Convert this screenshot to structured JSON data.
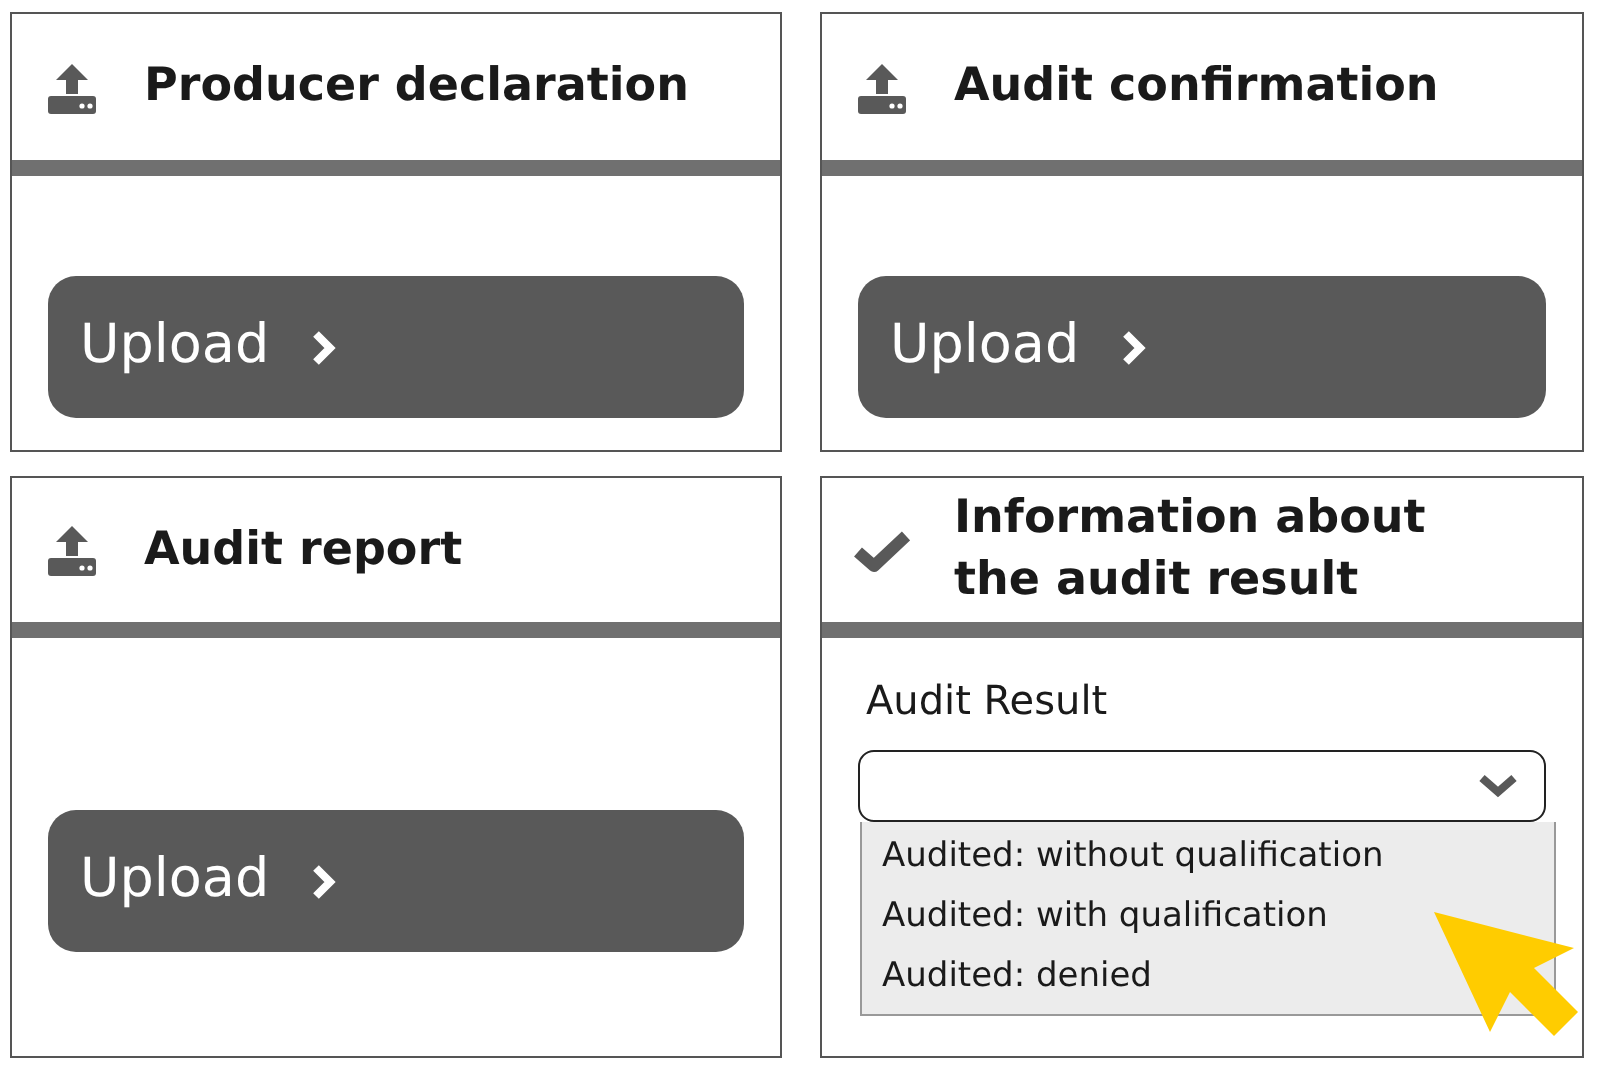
{
  "cards": [
    {
      "title": "Producer declaration",
      "kind": "button",
      "button": "Upload"
    },
    {
      "title": "Audit confirmation",
      "kind": "button",
      "button": "Upload"
    },
    {
      "title": "Audit report",
      "kind": "button",
      "button": "Upload"
    },
    {
      "title": "Information about the audit result",
      "kind": "dropdown",
      "label": "Audit Result",
      "expanded": true,
      "options": [
        "Audited: without qualification",
        "Audited: with qualification",
        "Audited: denied"
      ]
    }
  ]
}
